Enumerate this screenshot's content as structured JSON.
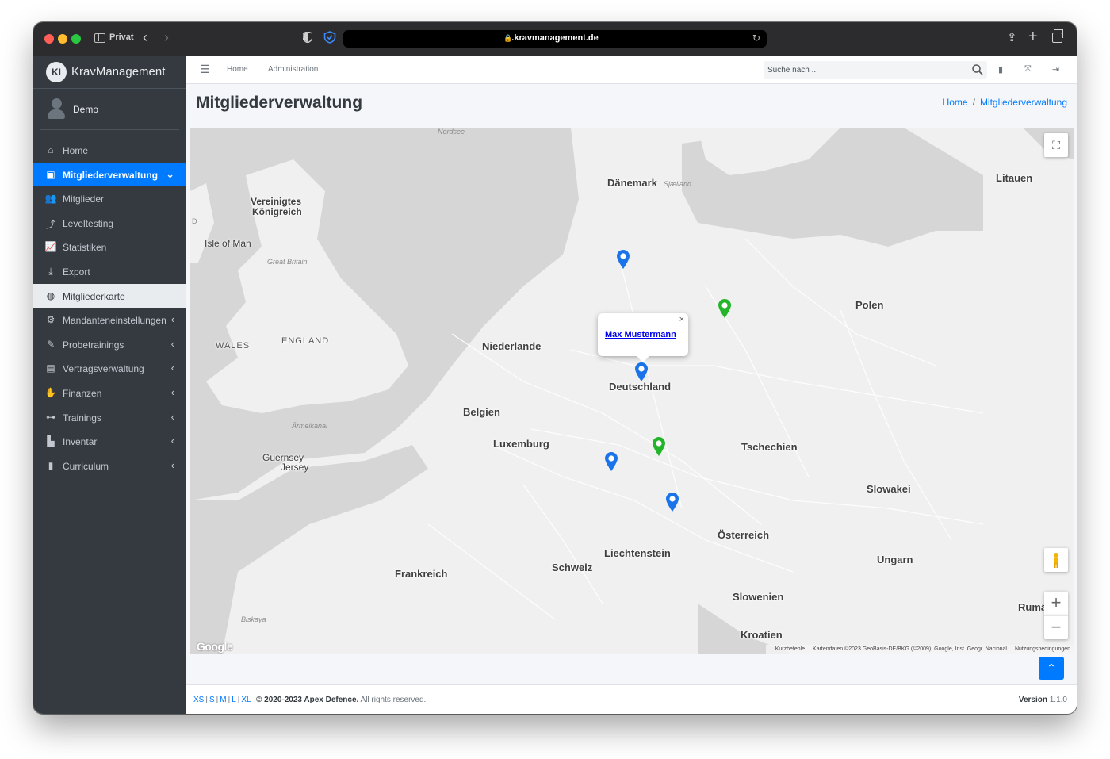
{
  "browser": {
    "private_label": "Privat",
    "url": ".kravmanagement.de"
  },
  "sidebar": {
    "brand_logo": "KI",
    "brand_name": "KravManagement",
    "user_name": "Demo",
    "items": [
      {
        "label": "Home",
        "icon": "home-icon"
      },
      {
        "label": "Mitgliederverwaltung",
        "icon": "id-card-icon"
      },
      {
        "label": "Mitglieder",
        "icon": "users-icon"
      },
      {
        "label": "Leveltesting",
        "icon": "level-up-icon"
      },
      {
        "label": "Statistiken",
        "icon": "chart-line-icon"
      },
      {
        "label": "Export",
        "icon": "download-icon"
      },
      {
        "label": "Mitgliederkarte",
        "icon": "globe-icon"
      },
      {
        "label": "Mandanteneinstellungen",
        "icon": "cogs-icon"
      },
      {
        "label": "Probetrainings",
        "icon": "pen-icon"
      },
      {
        "label": "Vertragsverwaltung",
        "icon": "file-contract-icon"
      },
      {
        "label": "Finanzen",
        "icon": "hand-holding-dollar-icon"
      },
      {
        "label": "Trainings",
        "icon": "dumbbell-icon"
      },
      {
        "label": "Inventar",
        "icon": "pallet-icon"
      },
      {
        "label": "Curriculum",
        "icon": "book-icon"
      }
    ]
  },
  "header": {
    "links": [
      "Home",
      "Administration"
    ],
    "search_placeholder": "Suche nach ..."
  },
  "page": {
    "title": "Mitgliederverwaltung",
    "breadcrumb": [
      "Home",
      "Mitgliederverwaltung"
    ]
  },
  "map": {
    "labels": {
      "nordsee": "Nordsee",
      "daenemark": "Dänemark",
      "sjaelland": "Sjælland",
      "litauen": "Litauen",
      "vereinigtes": "Vereinigtes",
      "koenigreich": "Königreich",
      "isle_of_man": "Isle of Man",
      "great_britain": "Great Britain",
      "d": "D",
      "wales": "WALES",
      "england": "ENGLAND",
      "niederlande": "Niederlande",
      "polen": "Polen",
      "deutschland": "Deutschland",
      "belgien": "Belgien",
      "luxemburg": "Luxemburg",
      "aermelkanal": "Ärmelkanal",
      "guernsey": "Guernsey",
      "jersey": "Jersey",
      "tschechien": "Tschechien",
      "slowakei": "Slowakei",
      "oesterreich": "Österreich",
      "liechtenstein": "Liechtenstein",
      "schweiz": "Schweiz",
      "frankreich": "Frankreich",
      "ungarn": "Ungarn",
      "slowenien": "Slowenien",
      "kroatien": "Kroatien",
      "rumaenien": "Rumä",
      "biskaya": "Biskaya"
    },
    "infowindow_name": "Max Mustermann",
    "infowindow_close": "×",
    "google_logo": "Google",
    "attribution": {
      "shortcuts": "Kurzbefehle",
      "data": "Kartendaten ©2023 GeoBasis-DE/BKG (©2009), Google, Inst. Geogr. Nacional",
      "terms": "Nutzungsbedingungen"
    },
    "pin_colors": {
      "blue": "#1a73e8",
      "green": "#22b52a"
    }
  },
  "footer": {
    "breakpoints": [
      "XS",
      "S",
      "M",
      "L",
      "XL"
    ],
    "copyright_bold": "© 2020-2023 Apex Defence.",
    "copyright_rest": " All rights reserved.",
    "version_label": "Version",
    "version_value": "1.1.0"
  },
  "colors": {
    "primary": "#007bff",
    "sidebar_bg": "#343a40"
  }
}
